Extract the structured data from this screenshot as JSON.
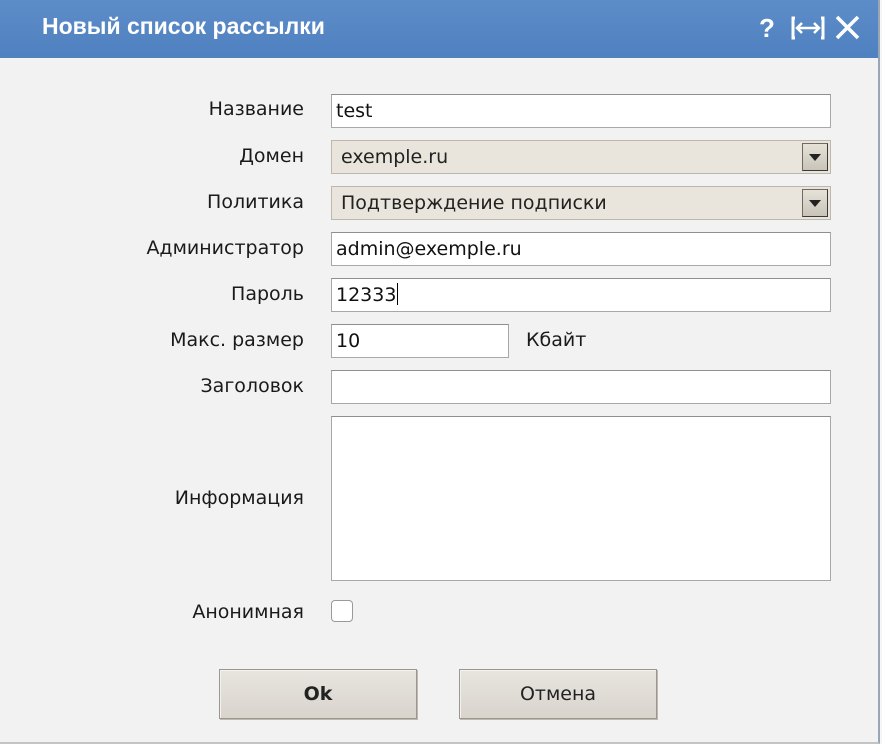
{
  "dialog": {
    "title": "Новый список рассылки",
    "help_glyph": "?",
    "icons": [
      "help-icon",
      "maximize-icon",
      "close-icon"
    ]
  },
  "form": {
    "name_label": "Название",
    "name_value": "test",
    "domain_label": "Домен",
    "domain_value": "exemple.ru",
    "policy_label": "Политика",
    "policy_value": "Подтверждение подписки",
    "admin_label": "Администратор",
    "admin_value": "admin@exemple.ru",
    "password_label": "Пароль",
    "password_value": "12333",
    "maxsize_label": "Макс. размер",
    "maxsize_value": "10",
    "maxsize_unit": "Кбайт",
    "header_label": "Заголовок",
    "header_value": "",
    "info_label": "Информация",
    "info_value": "",
    "anonymous_label": "Анонимная",
    "anonymous_checked": false
  },
  "buttons": {
    "ok_label": "Ok",
    "cancel_label": "Отмена"
  },
  "colors": {
    "titlebar": "#5587c5",
    "background": "#f2f2f2",
    "select_background": "#e9e5dc"
  }
}
